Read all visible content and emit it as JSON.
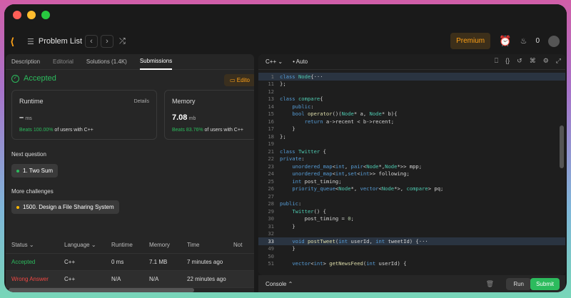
{
  "nav": {
    "problem_list": "Problem List",
    "premium": "Premium",
    "streak_count": "0"
  },
  "tabs": [
    "Description",
    "Editorial",
    "Solutions (1.4K)",
    "Submissions"
  ],
  "result": {
    "status": "Accepted",
    "editorial_btn": "Edito"
  },
  "runtime": {
    "title": "Runtime",
    "details": "Details",
    "value": "–",
    "unit": "ms",
    "beats_pct": "Beats 100.00%",
    "beats_rest": " of users with C++"
  },
  "memory": {
    "title": "Memory",
    "value": "7.08",
    "unit": "mb",
    "beats_pct": "Beats 83.76%",
    "beats_rest": " of users with C++"
  },
  "next_question": {
    "label": "Next question",
    "item": "1. Two Sum"
  },
  "more_challenges": {
    "label": "More challenges",
    "item": "1500. Design a File Sharing System"
  },
  "table": {
    "headers": [
      "Status",
      "Language",
      "Runtime",
      "Memory",
      "Time",
      "Not"
    ],
    "rows": [
      {
        "status": "Accepted",
        "lang": "C++",
        "runtime": "0 ms",
        "memory": "7.1 MB",
        "time": "7 minutes ago"
      },
      {
        "status": "Wrong Answer",
        "lang": "C++",
        "runtime": "N/A",
        "memory": "N/A",
        "time": "22 minutes ago"
      }
    ]
  },
  "editor": {
    "language": "C++",
    "mode": "Auto"
  },
  "code_lines": [
    {
      "n": "1",
      "t": "class Node{···"
    },
    {
      "n": "11",
      "t": "};"
    },
    {
      "n": "12",
      "t": ""
    },
    {
      "n": "13",
      "t": "class compare{"
    },
    {
      "n": "14",
      "t": "    public:"
    },
    {
      "n": "15",
      "t": "    bool operator()(Node* a, Node* b){"
    },
    {
      "n": "16",
      "t": "        return a->recent < b->recent;"
    },
    {
      "n": "17",
      "t": "    }"
    },
    {
      "n": "18",
      "t": "};"
    },
    {
      "n": "19",
      "t": ""
    },
    {
      "n": "21",
      "t": "class Twitter {"
    },
    {
      "n": "22",
      "t": "private:"
    },
    {
      "n": "23",
      "t": "    unordered_map<int, pair<Node*,Node*>> mpp;"
    },
    {
      "n": "24",
      "t": "    unordered_map<int,set<int>> following;"
    },
    {
      "n": "25",
      "t": "    int post_timing;"
    },
    {
      "n": "26",
      "t": "    priority_queue<Node*, vector<Node*>, compare> pq;"
    },
    {
      "n": "27",
      "t": ""
    },
    {
      "n": "28",
      "t": "public:"
    },
    {
      "n": "29",
      "t": "    Twitter() {"
    },
    {
      "n": "30",
      "t": "        post_timing = 0;"
    },
    {
      "n": "31",
      "t": "    }"
    },
    {
      "n": "32",
      "t": ""
    },
    {
      "n": "33",
      "t": "    void postTweet(int userId, int tweetId) {···"
    },
    {
      "n": "49",
      "t": "    }"
    },
    {
      "n": "50",
      "t": ""
    },
    {
      "n": "51",
      "t": "    vector<int> getNewsFeed(int userId) {"
    }
  ],
  "console": {
    "label": "Console",
    "run": "Run",
    "submit": "Submit"
  }
}
